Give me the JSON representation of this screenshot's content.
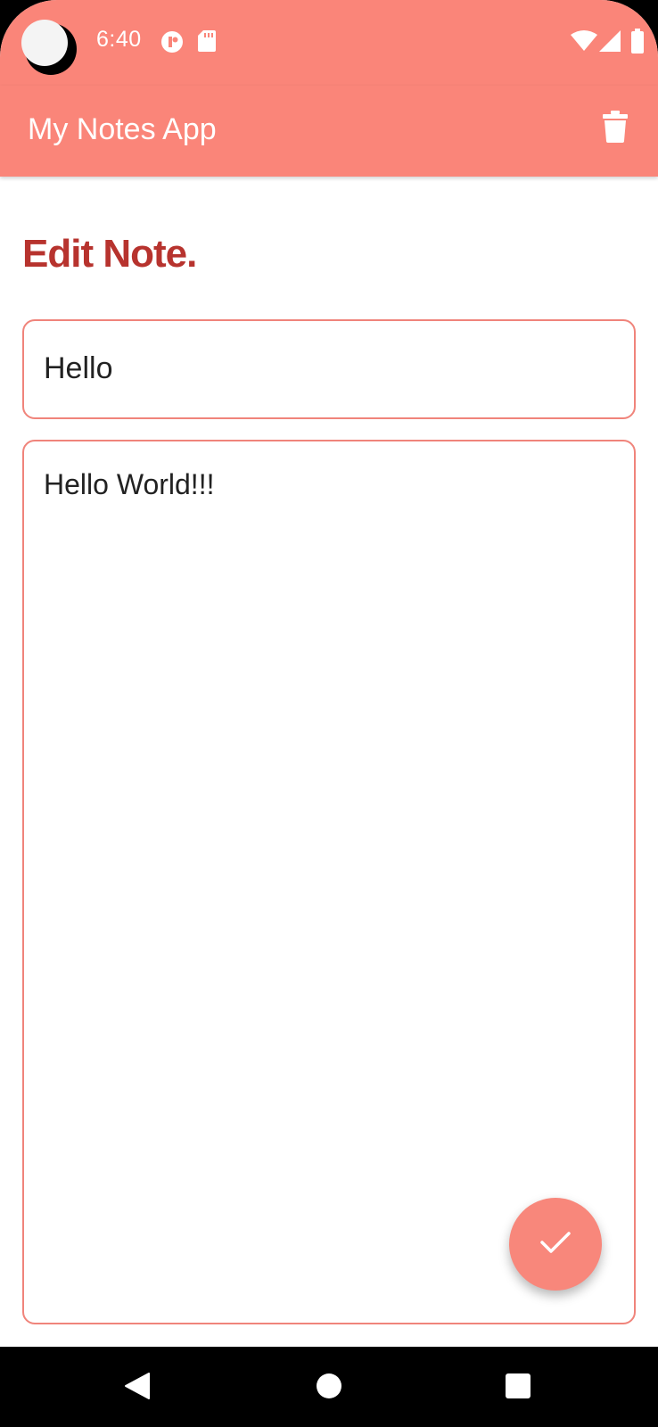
{
  "status_bar": {
    "time": "6:40",
    "icons": [
      "notification-r-icon",
      "sd-card-icon",
      "wifi-icon",
      "signal-icon",
      "battery-icon"
    ]
  },
  "app_bar": {
    "title": "My Notes App",
    "action_icon": "trash-icon"
  },
  "editor": {
    "heading": "Edit Note.",
    "title_value": "Hello",
    "body_value": "Hello World!!!"
  },
  "fab": {
    "icon": "check-icon"
  },
  "nav_bar": {
    "icons": [
      "back-icon",
      "home-icon",
      "recents-icon"
    ]
  },
  "colors": {
    "primary": "#fa8579",
    "heading": "#b7332e",
    "field_border": "#f0847b",
    "fab": "#f8877b"
  }
}
